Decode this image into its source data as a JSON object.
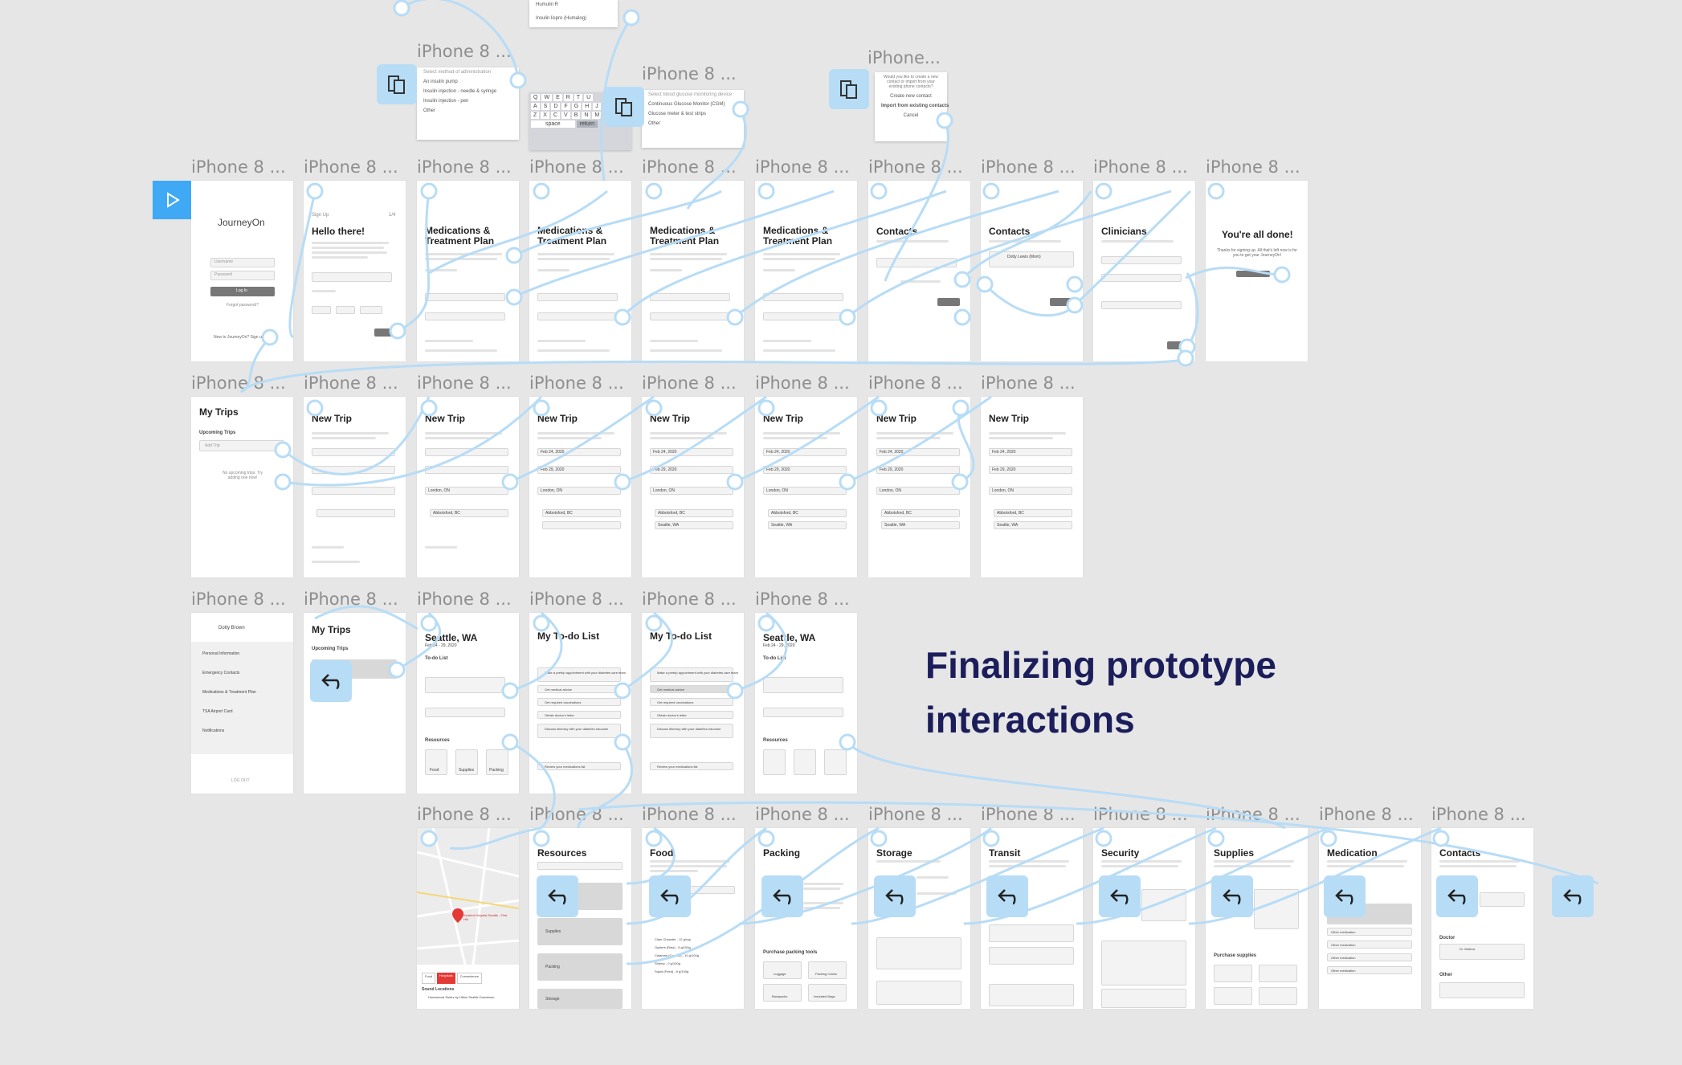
{
  "frame_label": "iPhone 8 ...",
  "frame_label_short": "iPhone...",
  "headline": "Finalizing prototype interactions",
  "keyboard": {
    "row1": [
      "Q",
      "W",
      "E",
      "R",
      "T",
      "U"
    ],
    "row2": [
      "A",
      "S",
      "D",
      "F",
      "G",
      "H",
      "J"
    ],
    "row3": [
      "Z",
      "X",
      "C",
      "V",
      "B",
      "N",
      "M"
    ],
    "space": "space",
    "return": "return"
  },
  "popups": {
    "top_list": [
      "Humulin R",
      "Insulin lispro (Humalog)"
    ],
    "admin_method": [
      "Select method of administration",
      "An insulin pump",
      "Insulin injection - needle & syringe",
      "Insulin injection - pen",
      "Other"
    ],
    "glucose_device": [
      "Select blood glucose monitoring device",
      "Continuous Glucose Monitor (CGM)",
      "Glucose meter & test strips",
      "Other"
    ],
    "contacts": [
      "Would you like to create a new contact or import from your existing phone contacts?",
      "Create new contact",
      "Import from existing contacts",
      "Cancel"
    ]
  },
  "screens": {
    "login": {
      "title": "JourneyOn",
      "username": "Username",
      "password": "Password",
      "login_btn": "Log In",
      "forgot": "Forgot password?",
      "new": "New to JourneyOn? Sign up"
    },
    "hello": {
      "step": "Sign Up",
      "page": "1/4",
      "title": "Hello there!"
    },
    "meds1": {
      "title": "Medications & Treatment Plan"
    },
    "meds2": {
      "title": "Medications & Treatment Plan"
    },
    "meds3": {
      "title": "Medications & Treatment Plan"
    },
    "meds4": {
      "title": "Medications & Treatment Plan"
    },
    "contacts1": {
      "title": "Contacts"
    },
    "contacts2": {
      "title": "Contacts",
      "contact": "Dotty Lewis (Mom)"
    },
    "clinicians": {
      "title": "Clinicians"
    },
    "done": {
      "title": "You're all done!",
      "text": "Thanks for signing up. All that's left now is for you to get your JourneyOn!"
    },
    "mytrips": {
      "title": "My Trips",
      "subtitle": "Upcoming Trips",
      "add": "Add Trip",
      "empty": "No upcoming trips. Try adding one now!"
    },
    "newtrip": {
      "title": "New Trip",
      "date1": "Feb 24, 2020",
      "date2": "Feb 29, 2020",
      "from": "London, ON",
      "dest1": "Abbotsford, BC",
      "dest2": "Seattle, WA"
    },
    "profile": {
      "name": "Dotty Brown",
      "items": [
        "Personal Information",
        "Emergency Contacts",
        "Medications & Treatment Plan",
        "TSA Airport Card",
        "Notifications"
      ],
      "logout": "LOG OUT"
    },
    "mytrips2": {
      "title": "My Trips",
      "subtitle": "Upcoming Trips"
    },
    "seattle": {
      "title": "Seattle, WA",
      "dates": "Feb 24 - 29, 2020",
      "todo": "To-do List",
      "resources": "Resources",
      "tiles": [
        "Food",
        "Supplies",
        "Packing"
      ]
    },
    "todo": {
      "title": "My To-do List",
      "items": [
        "Make a pretrip appointment with your diabetes care team",
        "Get medical advice",
        "Get required vaccinations",
        "Obtain doctor's letter",
        "Discuss itinerary with your diabetes educator",
        "Review your medications list"
      ]
    },
    "map": {
      "tabs": [
        "Food",
        "Hospitals",
        "Convenience"
      ],
      "label": "Kindred Hospital Seattle - First Hill",
      "found": "Sound Locations",
      "hotel": "Homewood Suites by Hilton Seattle Downtown"
    },
    "resources": {
      "title": "Resources",
      "items": [
        "Food",
        "Supplies",
        "Packing",
        "Storage"
      ]
    },
    "food": {
      "title": "Food",
      "items": [
        "Clam Chowder - 12 g/cup",
        "Oysters (Raw) - 5 g/100g",
        "Calamari (Cooked) - 10 g/100g",
        "Shrimp - 0 g/100g",
        "Squid (Fried) - 8 g/100g"
      ]
    },
    "packing": {
      "title": "Packing",
      "tools": "Purchase packing tools",
      "tiles": [
        "Luggage",
        "Packing Cubes",
        "Backpacks",
        "Insulated Bags"
      ]
    },
    "storage": {
      "title": "Storage"
    },
    "transit": {
      "title": "Transit"
    },
    "security": {
      "title": "Security"
    },
    "supplies": {
      "title": "Supplies",
      "purchase": "Purchase supplies"
    },
    "medication": {
      "title": "Medication",
      "items": [
        "Other medication",
        "Other medication",
        "Other medication",
        "Other medication"
      ]
    },
    "contacts3": {
      "title": "Contacts",
      "doctor": "Doctor",
      "other": "Other",
      "dr": "Dr. Maleva"
    }
  },
  "colors": {
    "wire": "#b7dcf6",
    "accent": "#3fa9f5",
    "headline": "#1b1e5a"
  }
}
